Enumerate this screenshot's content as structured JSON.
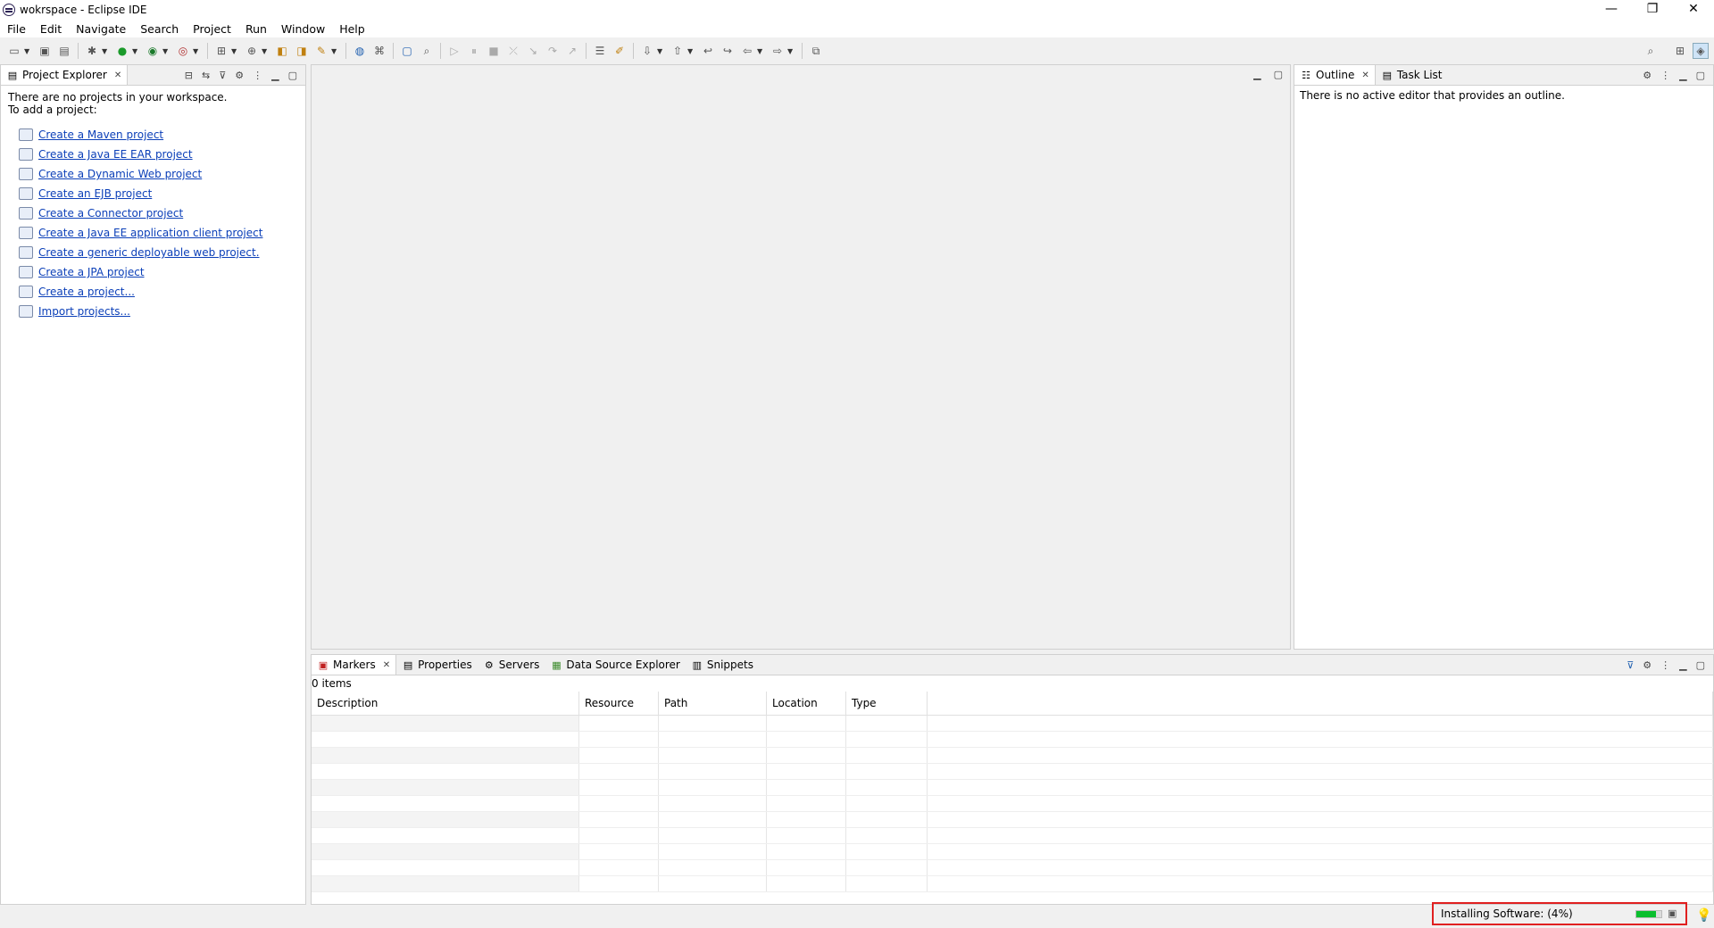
{
  "window": {
    "title": "wokrspace - Eclipse IDE"
  },
  "menu": [
    "File",
    "Edit",
    "Navigate",
    "Search",
    "Project",
    "Run",
    "Window",
    "Help"
  ],
  "project_explorer": {
    "tab_label": "Project Explorer",
    "message_line1": "There are no projects in your workspace.",
    "message_line2": "To add a project:",
    "links": [
      "Create a Maven project",
      "Create a Java EE EAR project",
      "Create a Dynamic Web project",
      "Create an EJB project",
      "Create a Connector project",
      "Create a Java EE application client project",
      "Create a generic deployable web project.",
      "Create a JPA project",
      "Create a project...",
      "Import projects..."
    ]
  },
  "right_panel": {
    "tabs": [
      "Outline",
      "Task List"
    ],
    "message": "There is no active editor that provides an outline."
  },
  "bottom_panel": {
    "tabs": [
      "Markers",
      "Properties",
      "Servers",
      "Data Source Explorer",
      "Snippets"
    ],
    "count": "0 items",
    "columns": [
      "Description",
      "Resource",
      "Path",
      "Location",
      "Type"
    ]
  },
  "status": {
    "progress_text": "Installing Software: (4%)",
    "progress_fraction": 0.04,
    "progress_color": "#0abf2e"
  }
}
